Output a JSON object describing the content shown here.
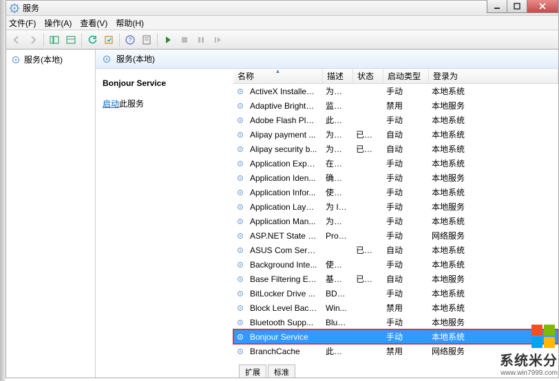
{
  "title": "服务",
  "menus": {
    "file": "文件(F)",
    "action": "操作(A)",
    "view": "查看(V)",
    "help": "帮助(H)"
  },
  "nav": {
    "label": "服务(本地)"
  },
  "header": {
    "label": "服务(本地)"
  },
  "detail": {
    "service_name": "Bonjour Service",
    "action_link": "启动",
    "action_suffix": "此服务"
  },
  "columns": {
    "name": "名称",
    "desc": "描述",
    "status": "状态",
    "startup": "启动类型",
    "logon": "登录为"
  },
  "tabs": {
    "extended": "扩展",
    "standard": "标准"
  },
  "watermark": {
    "text": "系统米分",
    "url": "www.win7999.com",
    "c1": "#f25022",
    "c2": "#7fba00",
    "c3": "#00a4ef",
    "c4": "#ffb900"
  },
  "rows": [
    {
      "name": "ActiveX Installer ...",
      "desc": "为从 ...",
      "status": "",
      "startup": "手动",
      "logon": "本地系统"
    },
    {
      "name": "Adaptive Brightn...",
      "desc": "监视...",
      "status": "",
      "startup": "禁用",
      "logon": "本地服务"
    },
    {
      "name": "Adobe Flash Pla...",
      "desc": "此服...",
      "status": "",
      "startup": "手动",
      "logon": "本地系统"
    },
    {
      "name": "Alipay payment ...",
      "desc": "为支...",
      "status": "已启动",
      "startup": "自动",
      "logon": "本地系统"
    },
    {
      "name": "Alipay security b...",
      "desc": "为支...",
      "status": "已启动",
      "startup": "自动",
      "logon": "本地系统"
    },
    {
      "name": "Application Expe...",
      "desc": "在应...",
      "status": "",
      "startup": "手动",
      "logon": "本地系统"
    },
    {
      "name": "Application Iden...",
      "desc": "确定...",
      "status": "",
      "startup": "手动",
      "logon": "本地服务"
    },
    {
      "name": "Application Infor...",
      "desc": "使用...",
      "status": "",
      "startup": "手动",
      "logon": "本地系统"
    },
    {
      "name": "Application Laye...",
      "desc": "为 In...",
      "status": "",
      "startup": "手动",
      "logon": "本地服务"
    },
    {
      "name": "Application Man...",
      "desc": "为通...",
      "status": "",
      "startup": "手动",
      "logon": "本地系统"
    },
    {
      "name": "ASP.NET State S...",
      "desc": "Prov...",
      "status": "",
      "startup": "手动",
      "logon": "网络服务"
    },
    {
      "name": "ASUS Com Servi...",
      "desc": "",
      "status": "已启动",
      "startup": "自动",
      "logon": "本地系统"
    },
    {
      "name": "Background Inte...",
      "desc": "使用...",
      "status": "",
      "startup": "手动",
      "logon": "本地系统"
    },
    {
      "name": "Base Filtering En...",
      "desc": "基本...",
      "status": "已启动",
      "startup": "自动",
      "logon": "本地服务"
    },
    {
      "name": "BitLocker Drive ...",
      "desc": "BDE...",
      "status": "",
      "startup": "手动",
      "logon": "本地系统"
    },
    {
      "name": "Block Level Back...",
      "desc": "Win...",
      "status": "",
      "startup": "禁用",
      "logon": "本地系统"
    },
    {
      "name": "Bluetooth Supp...",
      "desc": "Blue...",
      "status": "",
      "startup": "手动",
      "logon": "本地服务"
    },
    {
      "name": "Bonjour Service",
      "desc": "",
      "status": "",
      "startup": "手动",
      "logon": "本地系统",
      "selected": true,
      "highlight": true
    },
    {
      "name": "BranchCache",
      "desc": "此服...",
      "status": "",
      "startup": "禁用",
      "logon": "网络服务"
    }
  ]
}
